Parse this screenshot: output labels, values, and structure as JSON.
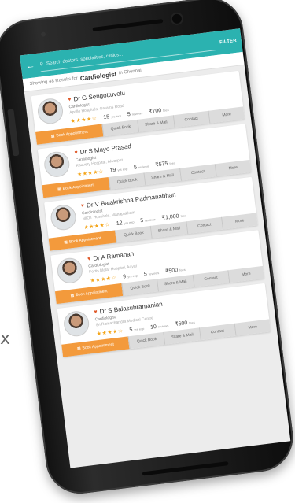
{
  "edge_glyph": "x",
  "app": {
    "header": {
      "back_icon": "arrow-left",
      "search_icon": "search",
      "search_text": "Search doctors, specialities, clinics...",
      "filter_label": "FILTER"
    },
    "results": {
      "prefix": "Showing 48 Results for",
      "speciality": "Cardiologist",
      "suffix": "in Chennai"
    },
    "doctors": [
      {
        "name": "Dr G Sengottuvelu",
        "speciality": "Cardiologist",
        "address": "Apollo Hospitals, Greams Road",
        "stars": "★★★★☆",
        "stat1": "15",
        "stat1_unit": "yrs exp",
        "stat2": "5",
        "stat2_unit": "reviews",
        "fee": "₹700",
        "fee_unit": "fees",
        "actions": [
          "Book Appointment",
          "Quick Book",
          "Share & Mail",
          "Contact",
          "More"
        ]
      },
      {
        "name": "Dr S Mayo Prasad",
        "speciality": "Cardiologist",
        "address": "Kauvery Hospital, Alwarpet",
        "stars": "★★★★☆",
        "stat1": "19",
        "stat1_unit": "yrs exp",
        "stat2": "5",
        "stat2_unit": "reviews",
        "fee": "₹575",
        "fee_unit": "fees",
        "actions": [
          "Book Appointment",
          "Quick Book",
          "Share & Mail",
          "Contact",
          "More"
        ]
      },
      {
        "name": "Dr V Balakrishna Padmanabhan",
        "speciality": "Cardiologist",
        "address": "MIOT Hospitals, Manapakkam",
        "stars": "★★★★☆",
        "stat1": "12",
        "stat1_unit": "yrs exp",
        "stat2": "5",
        "stat2_unit": "reviews",
        "fee": "₹1,000",
        "fee_unit": "fees",
        "actions": [
          "Book Appointment",
          "Quick Book",
          "Share & Mail",
          "Contact",
          "More"
        ]
      },
      {
        "name": "Dr A Ramanan",
        "speciality": "Cardiologist",
        "address": "Fortis Malar Hospital, Adyar",
        "stars": "★★★★☆",
        "stat1": "9",
        "stat1_unit": "yrs exp",
        "stat2": "5",
        "stat2_unit": "reviews",
        "fee": "₹500",
        "fee_unit": "fees",
        "actions": [
          "Book Appointment",
          "Quick Book",
          "Share & Mail",
          "Contact",
          "More"
        ]
      },
      {
        "name": "Dr S Balasubramanian",
        "speciality": "Cardiologist",
        "address": "Sri Ramachandra Medical Centre",
        "stars": "★★★★☆",
        "stat1": "5",
        "stat1_unit": "yrs exp",
        "stat2": "10",
        "stat2_unit": "reviews",
        "fee": "₹600",
        "fee_unit": "fees",
        "actions": [
          "Book Appointment",
          "Quick Book",
          "Share & Mail",
          "Contact",
          "More"
        ]
      }
    ]
  },
  "colors": {
    "header": "#2bb2b0",
    "book_button": "#f39a3c",
    "stars": "#f4a61c"
  }
}
